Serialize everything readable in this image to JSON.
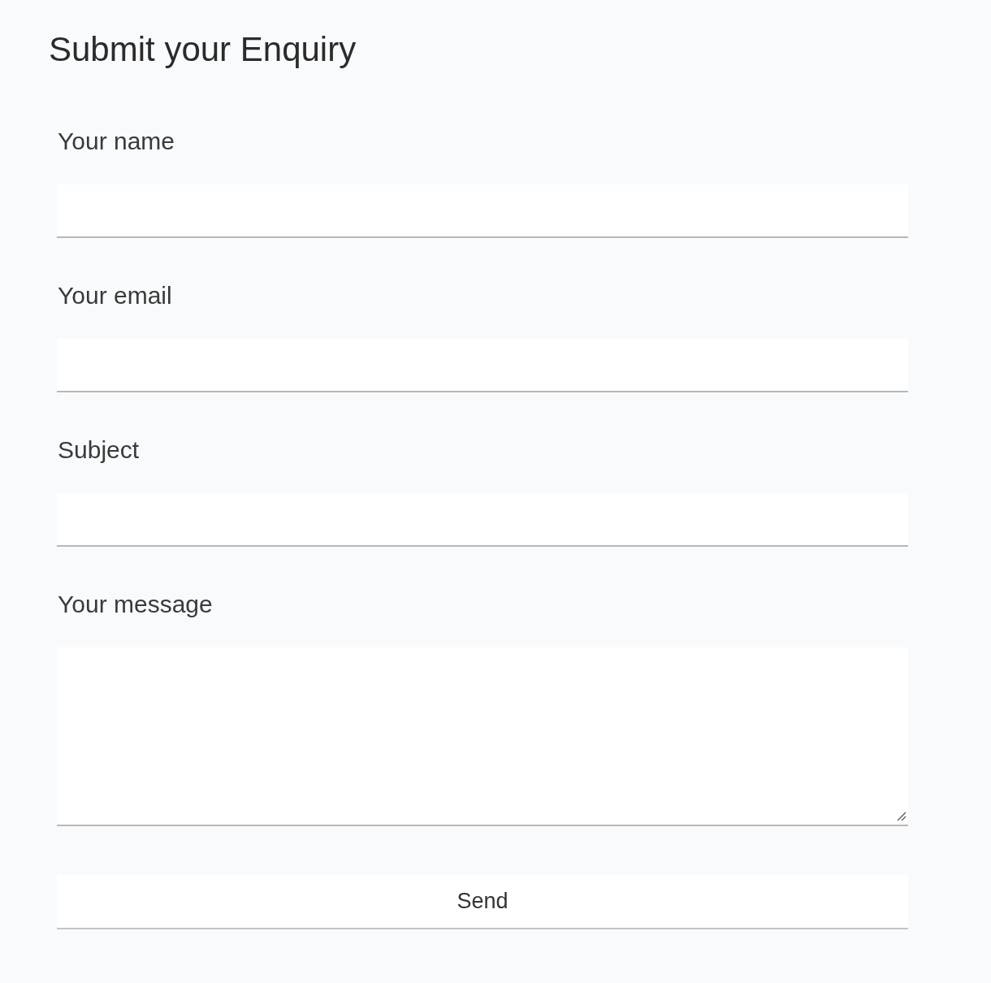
{
  "title": "Submit your Enquiry",
  "fields": [
    {
      "label": "Your name",
      "kind": "text"
    },
    {
      "label": "Your email",
      "kind": "text"
    },
    {
      "label": "Subject",
      "kind": "text"
    },
    {
      "label": "Your message",
      "kind": "textarea"
    }
  ],
  "submit": {
    "label": "Send"
  }
}
